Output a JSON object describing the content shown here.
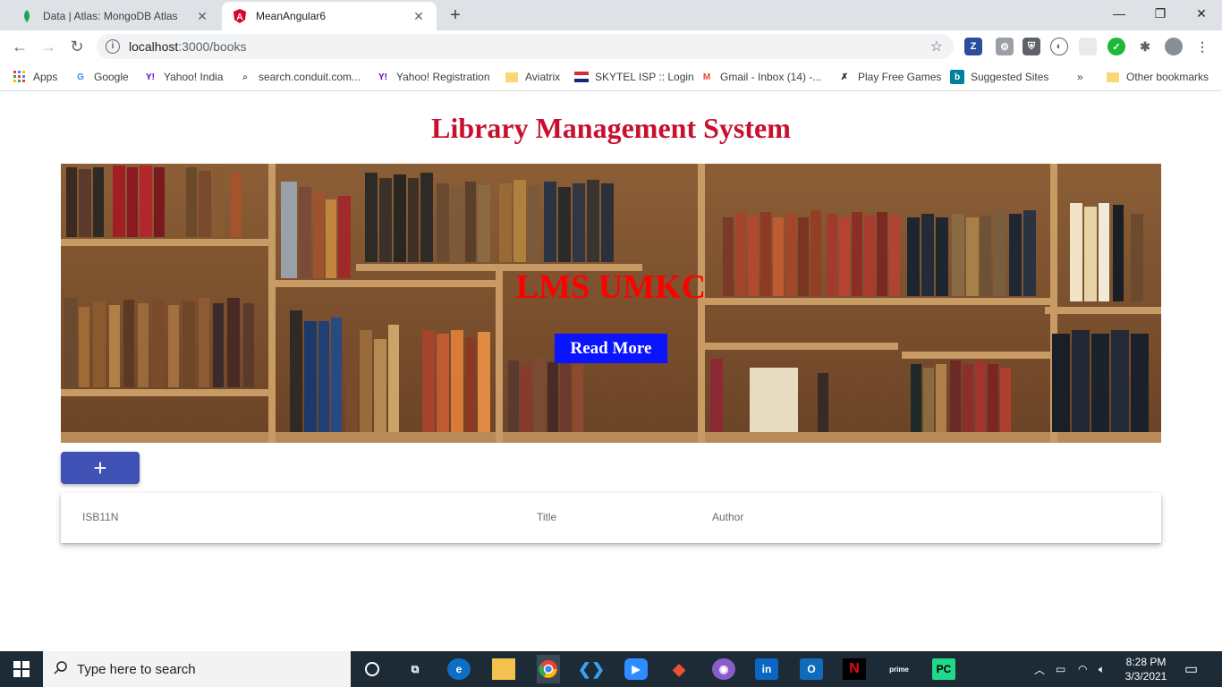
{
  "browser": {
    "tabs": [
      {
        "title": "Data | Atlas: MongoDB Atlas"
      },
      {
        "title": "MeanAngular6"
      }
    ],
    "address": {
      "host": "localhost",
      "path": ":3000/books"
    },
    "bookmarks": [
      {
        "label": "Apps"
      },
      {
        "label": "Google"
      },
      {
        "label": "Yahoo! India"
      },
      {
        "label": "search.conduit.com..."
      },
      {
        "label": "Yahoo! Registration"
      },
      {
        "label": "Aviatrix"
      },
      {
        "label": "SKYTEL ISP :: Login"
      },
      {
        "label": "Gmail - Inbox (14) -..."
      },
      {
        "label": "Play Free Games"
      },
      {
        "label": "Suggested Sites"
      },
      {
        "label": "»"
      },
      {
        "label": "Other bookmarks"
      }
    ]
  },
  "page": {
    "title": "Library Management System",
    "hero": {
      "title": "LMS UMKC",
      "button_label": "Read More"
    },
    "add_button_label": "+",
    "table": {
      "columns": [
        "ISB11N",
        "Title",
        "Author"
      ]
    }
  },
  "taskbar": {
    "search_placeholder": "Type here to search",
    "time": "8:28 PM",
    "date": "3/3/2021"
  },
  "colors": {
    "title_red": "#c8102e",
    "hero_title": "#ff0000",
    "hero_button": "#0a14ff",
    "add_button": "#3f51b5"
  }
}
